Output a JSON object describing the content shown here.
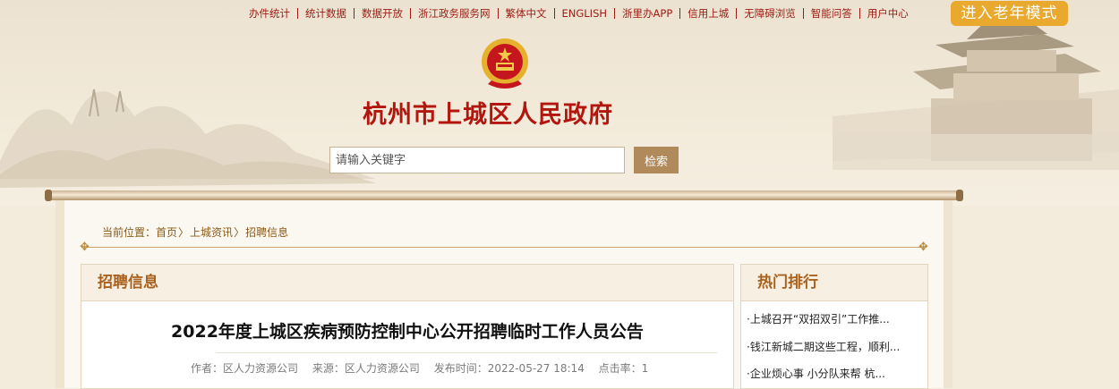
{
  "topnav": [
    "办件统计",
    "统计数据",
    "数据开放",
    "浙江政务服务网",
    "繁体中文",
    "ENGLISH",
    "浙里办APP",
    "信用上城",
    "无障碍浏览",
    "智能问答",
    "用户中心"
  ],
  "elder_mode": "进入老年模式",
  "site_title": "杭州市上城区人民政府",
  "search": {
    "placeholder": "请输入关键字",
    "button": "检索"
  },
  "breadcrumb": {
    "prefix": "当前位置：",
    "items": [
      "首页",
      "上城资讯",
      "招聘信息"
    ],
    "separator": "〉"
  },
  "main": {
    "section_title": "招聘信息",
    "article_title": "2022年度上城区疾病预防控制中心公开招聘临时工作人员公告",
    "meta": {
      "author": "作者：区人力资源公司",
      "source": "来源：区人力资源公司",
      "date": "发布时间：2022-05-27 18:14",
      "hits": "点击率：1"
    }
  },
  "hot": {
    "title": "热门排行",
    "items": [
      "·上城召开“双招双引”工作推...",
      "·钱江新城二期这些工程，顺利...",
      "·企业烦心事 小分队来帮 杭..."
    ]
  },
  "colors": {
    "nav_red": "#9d1b13",
    "title_red": "#b2160e",
    "elder_orange": "#e8a92e",
    "accent_brown": "#a9611d"
  }
}
